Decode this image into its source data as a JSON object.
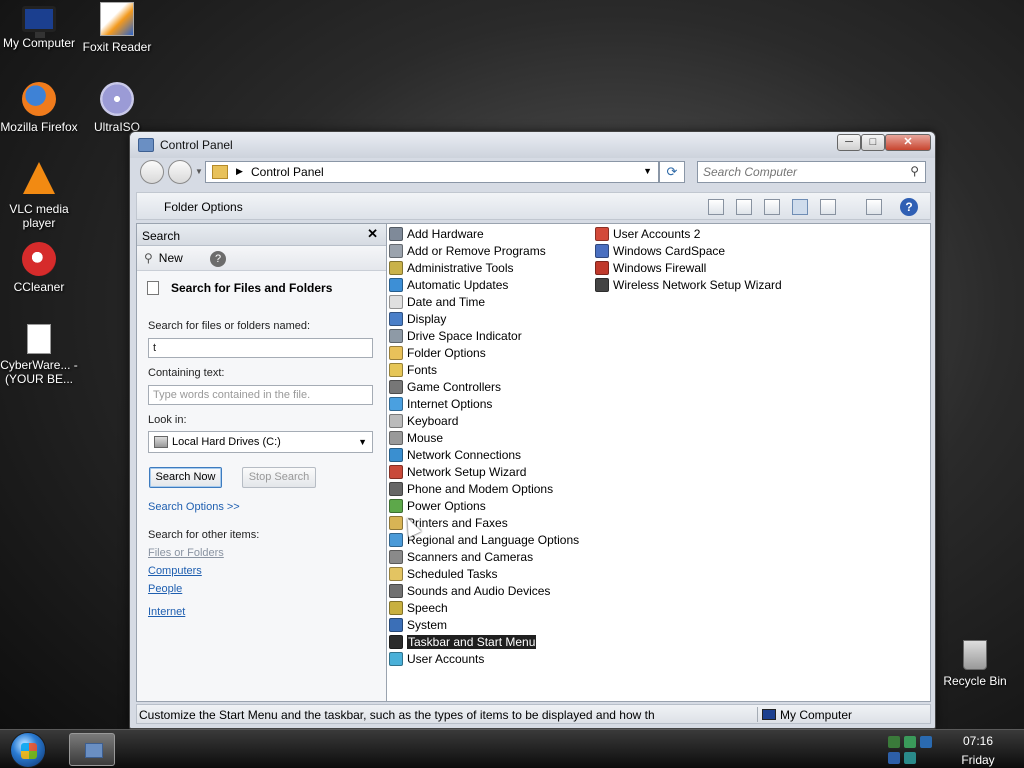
{
  "desktop": {
    "icons": [
      {
        "label": "My Computer"
      },
      {
        "label": "Foxit Reader"
      },
      {
        "label": "Mozilla Firefox"
      },
      {
        "label": "UltraISO"
      },
      {
        "label": "VLC media player"
      },
      {
        "label": "CCleaner"
      },
      {
        "label": "CyberWare... - (YOUR BE..."
      },
      {
        "label": "Recycle Bin"
      }
    ]
  },
  "window": {
    "title": "Control Panel",
    "minimize_glyph": "─",
    "maximize_glyph": "□",
    "close_glyph": "✕"
  },
  "address_bar": {
    "crumb": "Control Panel",
    "refresh_glyph": "⟳",
    "search_placeholder": "Search Computer",
    "search_glyph": "⚲"
  },
  "toolbar": {
    "folder_options_label": "Folder Options",
    "help_glyph": "?"
  },
  "search_pane": {
    "header": "Search",
    "close_glyph": "✕",
    "new_icon_glyph": "⚲",
    "new_label": "New",
    "help_glyph": "?",
    "title": "Search for Files and Folders",
    "named_label": "Search for files or folders named:",
    "named_value": "t",
    "containing_label": "Containing text:",
    "containing_placeholder": "Type words contained in the file.",
    "look_in_label": "Look in:",
    "look_in_value": "Local Hard Drives (C:)",
    "search_now": "Search Now",
    "stop_search": "Stop Search",
    "search_options": "Search Options >>",
    "other_items_label": "Search for other items:",
    "other_items": [
      "Files or Folders",
      "Computers",
      "People"
    ],
    "internet": "Internet"
  },
  "items": {
    "col1": [
      {
        "label": "Add Hardware",
        "color": "#7f8a99"
      },
      {
        "label": "Add or Remove Programs",
        "color": "#9ba3ad"
      },
      {
        "label": "Administrative Tools",
        "color": "#c9b24a"
      },
      {
        "label": "Automatic Updates",
        "color": "#3d8fd6"
      },
      {
        "label": "Date and Time",
        "color": "#e0e0e0"
      },
      {
        "label": "Display",
        "color": "#4a7fc8"
      },
      {
        "label": "Drive Space Indicator",
        "color": "#8e9aa6"
      },
      {
        "label": "Folder Options",
        "color": "#e8c15a"
      },
      {
        "label": "Fonts",
        "color": "#e6c657"
      },
      {
        "label": "Game Controllers",
        "color": "#777777"
      },
      {
        "label": "Internet Options",
        "color": "#4aa0e0"
      },
      {
        "label": "Keyboard",
        "color": "#bbbbbb"
      },
      {
        "label": "Mouse",
        "color": "#999999"
      },
      {
        "label": "Network Connections",
        "color": "#3a8fd0"
      },
      {
        "label": "Network Setup Wizard",
        "color": "#c94a3a"
      },
      {
        "label": "Phone and Modem Options",
        "color": "#666666"
      },
      {
        "label": "Power Options",
        "color": "#5da84a"
      },
      {
        "label": "Printers and Faxes",
        "color": "#d8b455"
      },
      {
        "label": "Regional and Language Options",
        "color": "#4a9ad8"
      },
      {
        "label": "Scanners and Cameras",
        "color": "#8a8a8a"
      },
      {
        "label": "Scheduled Tasks",
        "color": "#e3c462"
      },
      {
        "label": "Sounds and Audio Devices",
        "color": "#707070"
      },
      {
        "label": "Speech",
        "color": "#c8b040"
      },
      {
        "label": "System",
        "color": "#3b6fb7"
      },
      {
        "label": "Taskbar and Start Menu",
        "color": "#2b2b2b"
      },
      {
        "label": "User Accounts",
        "color": "#4ab0d8"
      }
    ],
    "col2": [
      {
        "label": "User Accounts 2",
        "color": "#d34a3a"
      },
      {
        "label": "Windows CardSpace",
        "color": "#4a6fc0"
      },
      {
        "label": "Windows Firewall",
        "color": "#c0392b"
      },
      {
        "label": "Wireless Network Setup Wizard",
        "color": "#444444"
      }
    ],
    "selected_index": 24
  },
  "status_bar": {
    "message": "Customize the Start Menu and the taskbar, such as the types of items to be displayed and how th",
    "location": "My Computer"
  },
  "taskbar": {
    "time": "07:16",
    "day": "Friday"
  }
}
